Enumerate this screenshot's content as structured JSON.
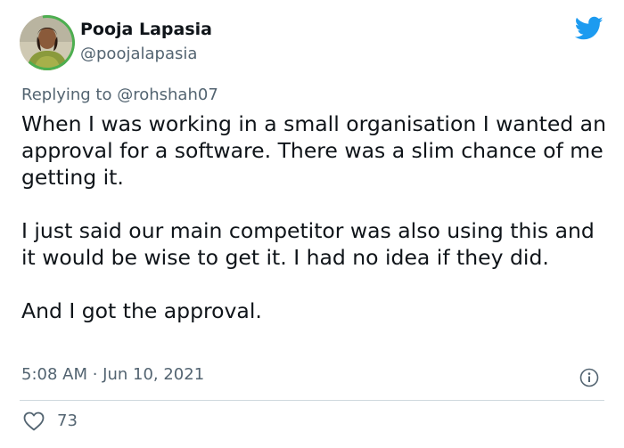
{
  "author": {
    "name": "Pooja Lapasia",
    "handle": "@poojalapasia"
  },
  "reply": {
    "prefix": "Replying to",
    "mention": "@rohshah07"
  },
  "tweet": {
    "paragraphs": [
      "When I was working in a small organisation I wanted an approval for a software. There was a slim chance of me getting it.",
      "I just said our main competitor was also using this and it would be wise to get it. I had no idea if they did.",
      "And I got the approval."
    ],
    "timestamp": "5:08 AM · Jun 10, 2021"
  },
  "stats": {
    "likes": "73"
  },
  "colors": {
    "twitter_blue": "#1d9bf0",
    "secondary_text": "#536471",
    "avatar_ring": "#4caf50"
  },
  "icons": {
    "brand": "twitter-bird-icon",
    "info": "info-icon",
    "like": "heart-icon"
  }
}
